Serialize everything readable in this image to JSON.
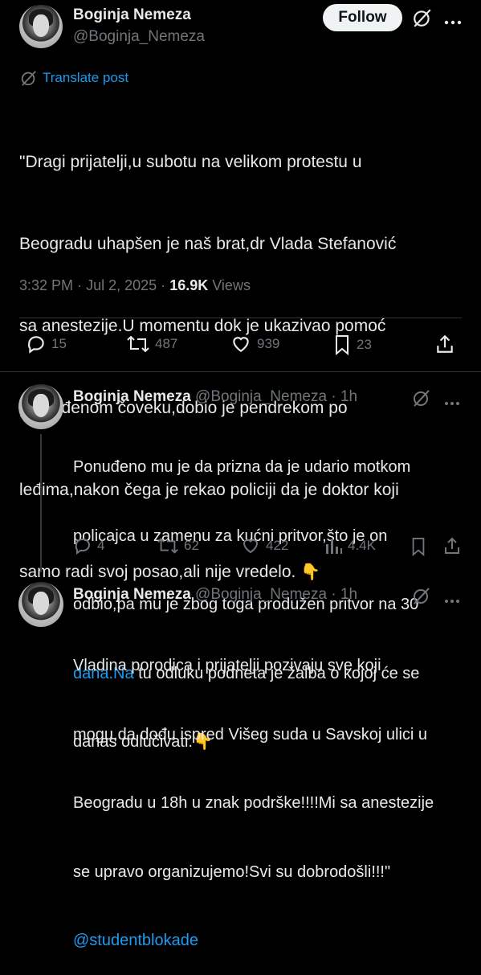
{
  "main_post": {
    "author_name": "Boginja Nemeza",
    "author_handle": "@Boginja_Nemeza",
    "follow_label": "Follow",
    "translate_label": "Translate post",
    "text_lines": [
      "\"Dragi prijatelji,u subotu na velikom protestu u",
      "Beogradu uhapšen je naš brat,dr Vlada Stefanović",
      "sa anestezije.U momentu dok je ukazivao pomoć",
      "povređenom čoveku,dobio je pendrekom po",
      "leđima,nakon čega je rekao policiji da je doktor koji",
      "samo radi svoj posao,ali nije vredelo."
    ],
    "emoji": "👇",
    "time": "3:32 PM",
    "date": "Jul 2, 2025",
    "views_count": "16.9K",
    "views_label": "Views",
    "replies": "15",
    "reposts": "487",
    "likes": "939",
    "bookmarks": "23"
  },
  "replies": [
    {
      "author_name": "Boginja Nemeza",
      "author_handle": "@Boginja_Nemeza",
      "time": "1h",
      "line1": "Ponuđeno mu je da prizna da je udario motkom",
      "line2": "policajca u zamenu za kućni pritvor,što je on",
      "line3": "odbio,pa mu je zbog toga produžen pritvor na 30",
      "line4_link": "dana.Na",
      "line4_rest": " tu odluku podneta je žalba o kojoj će se",
      "line5": "danas odlučivati.",
      "emoji": "👇",
      "replies": "4",
      "reposts": "62",
      "likes": "422",
      "views": "4.4K"
    },
    {
      "author_name": "Boginja Nemeza",
      "author_handle": "@Boginja_Nemeza",
      "time": "1h",
      "line1": "Vladina porodica i prijatelji pozivaju sve koji",
      "line2": "mogu,da dođu ispred Višeg suda u Savskoj ulici u",
      "line3": "Beogradu u 18h u znak podrške!!!!Mi sa anestezije",
      "line4": "se upravo organizujemo!Svi su dobrodošli!!!\"",
      "mention": "@studentblokade"
    }
  ],
  "separator": "·",
  "colors": {
    "background": "#000000",
    "text": "#e7e9ea",
    "muted": "#71767b",
    "link": "#1d9bf0",
    "divider": "#2f3336"
  }
}
